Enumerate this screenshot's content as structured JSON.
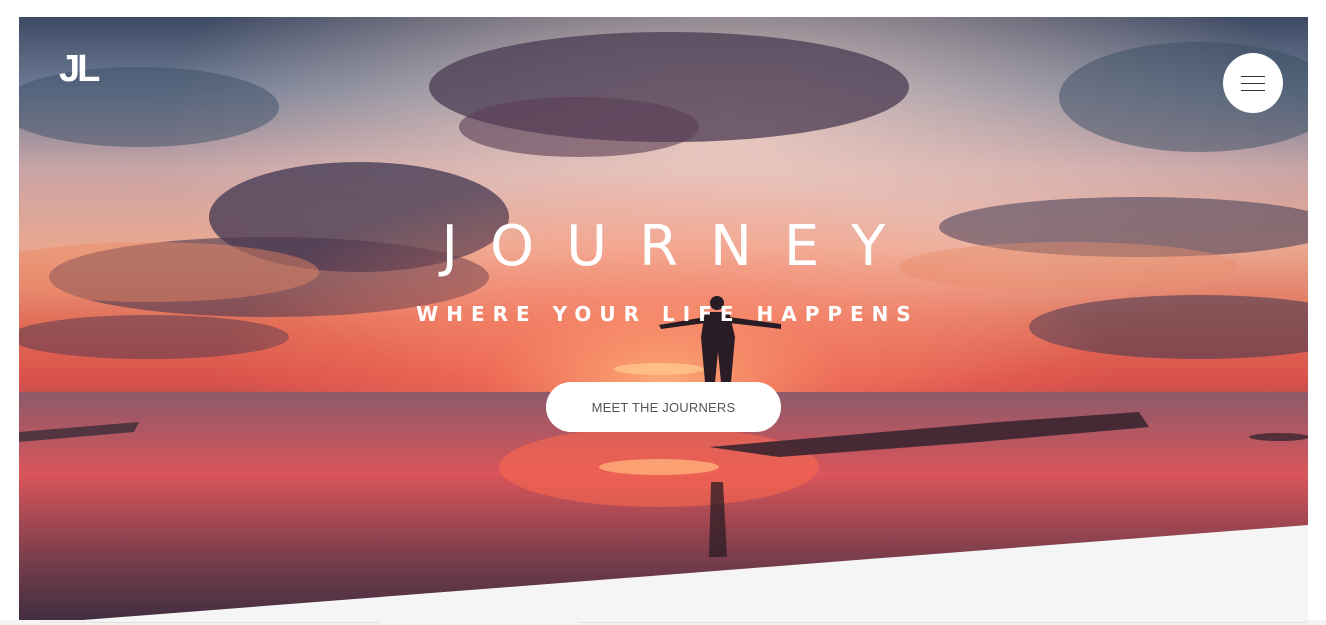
{
  "header": {
    "logo_text": "JL",
    "menu_icon": "hamburger-icon"
  },
  "hero": {
    "title": "JOURNEY",
    "subtitle": "WHERE YOUR LIFE HAPPENS",
    "cta_label": "MEET THE JOURNERS"
  },
  "colors": {
    "button_bg": "#ffffff",
    "button_text": "#555555",
    "section_bg": "#f5f5f5"
  }
}
